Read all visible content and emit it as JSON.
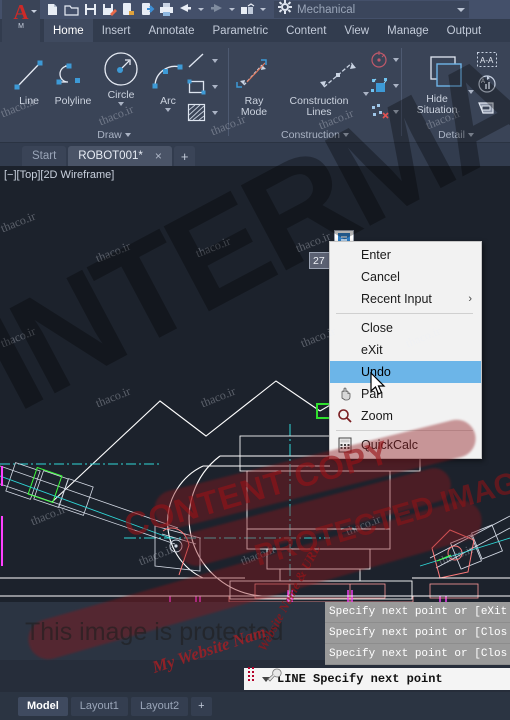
{
  "titlebar": {
    "app_menu_letter": "A",
    "app_menu_sub": "M",
    "workspace": "Mechanical",
    "quick_access_icons": [
      "new-file-icon",
      "open-folder-icon",
      "save-icon",
      "save-as-icon",
      "export-icon",
      "import-icon",
      "plot-icon",
      "undo-icon",
      "redo-icon",
      "workspace-switch-icon"
    ],
    "workspace_icon": "gear-icon"
  },
  "ribbon": {
    "tabs": [
      {
        "label": "Home",
        "active": true
      },
      {
        "label": "Insert",
        "active": false
      },
      {
        "label": "Annotate",
        "active": false
      },
      {
        "label": "Parametric",
        "active": false
      },
      {
        "label": "Content",
        "active": false
      },
      {
        "label": "View",
        "active": false
      },
      {
        "label": "Manage",
        "active": false
      },
      {
        "label": "Output",
        "active": false
      }
    ],
    "panels": [
      {
        "title": "Draw",
        "buttons": [
          {
            "label": "Line",
            "icon": "line-icon",
            "has_caret": false
          },
          {
            "label": "Polyline",
            "icon": "polyline-icon",
            "has_caret": false
          },
          {
            "label": "Circle",
            "icon": "circle-icon",
            "has_caret": true
          },
          {
            "label": "Arc",
            "icon": "arc-icon",
            "has_caret": true
          }
        ],
        "small_buttons": [
          {
            "icon": "line-small-icon"
          },
          {
            "icon": "rectangle-icon"
          },
          {
            "icon": "hatch-icon"
          }
        ]
      },
      {
        "title": "Construction",
        "buttons": [
          {
            "label": "Ray\nMode",
            "label_line1": "Ray",
            "label_line2": "Mode",
            "icon": "ray-mode-icon",
            "has_caret": false
          },
          {
            "label": "Construction Lines",
            "label_line1": "Construction",
            "label_line2": "Lines",
            "icon": "construction-lines-icon",
            "has_caret": true
          }
        ],
        "small_buttons": [
          {
            "icon": "centerline-icon"
          },
          {
            "icon": "construction-point-icon"
          },
          {
            "icon": "delete-construction-icon"
          }
        ]
      },
      {
        "title": "Detail",
        "buttons": [
          {
            "label": "Hide Situation",
            "label_line1": "Hide",
            "label_line2": "Situation",
            "icon": "hide-situation-icon",
            "has_caret": true
          }
        ],
        "small_buttons": [
          {
            "icon": "section-view-icon"
          },
          {
            "icon": "rotate-view-icon"
          },
          {
            "icon": "detail-view-icon"
          }
        ]
      }
    ]
  },
  "document_tabs": [
    {
      "label": "Start",
      "active": false,
      "closable": false
    },
    {
      "label": "ROBOT001*",
      "active": true,
      "closable": true,
      "close_glyph": "×"
    }
  ],
  "new_tab_glyph": "+",
  "canvas": {
    "viewport_label": "[−][Top][2D Wireframe]",
    "dynamic_tooltip_value": "27",
    "background_color": "#1c222c"
  },
  "context_menu": {
    "items": [
      {
        "label": "Enter",
        "selected": false,
        "separator_after": false,
        "submenu": false,
        "icon": null
      },
      {
        "label": "Cancel",
        "selected": false,
        "separator_after": false,
        "submenu": false,
        "icon": null
      },
      {
        "label": "Recent Input",
        "selected": false,
        "separator_after": true,
        "submenu": true,
        "submenu_glyph": "›",
        "icon": null
      },
      {
        "label": "Close",
        "selected": false,
        "separator_after": false,
        "submenu": false,
        "icon": null
      },
      {
        "label": "eXit",
        "selected": false,
        "separator_after": false,
        "submenu": false,
        "icon": null
      },
      {
        "label": "Undo",
        "selected": true,
        "separator_after": false,
        "submenu": false,
        "icon": null
      },
      {
        "label": "Pan",
        "selected": false,
        "separator_after": false,
        "submenu": false,
        "icon": "pan-hand-icon"
      },
      {
        "label": "Zoom",
        "selected": false,
        "separator_after": true,
        "submenu": false,
        "icon": "zoom-magnifier-icon"
      },
      {
        "label": "QuickCalc",
        "selected": false,
        "separator_after": false,
        "submenu": false,
        "icon": "calculator-icon"
      }
    ],
    "highlight_color": "#6cb5e8"
  },
  "command_line": {
    "history": [
      "Specify next point or [eXit",
      "Specify next point or [Clos",
      "Specify next point or [Clos"
    ],
    "active_prompt": "LINE Specify next point",
    "dropdown_glyph": "▾",
    "tool_icons": [
      "customize-icon",
      "wrench-icon"
    ]
  },
  "layout_tabs": [
    {
      "label": "Model",
      "active": true
    },
    {
      "label": "Layout1",
      "active": false
    },
    {
      "label": "Layout2",
      "active": false
    }
  ],
  "layout_add_glyph": "+",
  "watermarks": {
    "site_tiles": "thaco.ir",
    "big_text": "INTERMA",
    "protected_text": "This image is protected",
    "stamp_line1": "PROTECTED IMAGE",
    "stamp_line2": "CONTENT COPY",
    "site_name": "My Website Nam",
    "url_text": "Website Name & URL"
  },
  "colors": {
    "titlebar": "#44506a",
    "ribbon": "#3a4457",
    "canvas": "#1c222c",
    "accent_highlight": "#6cb5e8",
    "tab_active": "#4a5467",
    "cad_white": "#ffffff",
    "cad_cyan": "#2fd8d8",
    "cad_red": "#ff5e5e",
    "cad_magenta": "#ff40ff",
    "cad_green": "#3cff3c"
  }
}
